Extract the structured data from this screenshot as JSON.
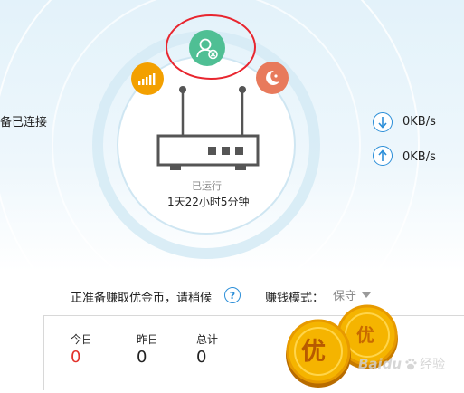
{
  "device_status": "备已连接",
  "router": {
    "status": "已运行",
    "uptime": "1天22小时5分钟"
  },
  "speeds": {
    "download": "0KB/s",
    "upload": "0KB/s"
  },
  "earning": {
    "status_text": "正准备赚取优金币，请稍候",
    "help": "?",
    "mode_label": "赚钱模式：",
    "mode_value": "保守"
  },
  "stats": [
    {
      "label": "今日",
      "value": "0",
      "color": "#e2312a"
    },
    {
      "label": "昨日",
      "value": "0",
      "color": "#222222"
    },
    {
      "label": "总计",
      "value": "0",
      "color": "#222222"
    }
  ],
  "coin": {
    "char": "优"
  },
  "watermark": {
    "brand": "Baidu",
    "suffix": "经验"
  },
  "colors": {
    "green": "#4fbf94",
    "orange": "#f3a000",
    "salmon": "#e87a5c",
    "blue": "#2b8ed8",
    "red_outline": "#e8262f"
  },
  "icons": {
    "center": "user-block-icon",
    "left": "signal-icon",
    "right": "moon-star-icon"
  }
}
